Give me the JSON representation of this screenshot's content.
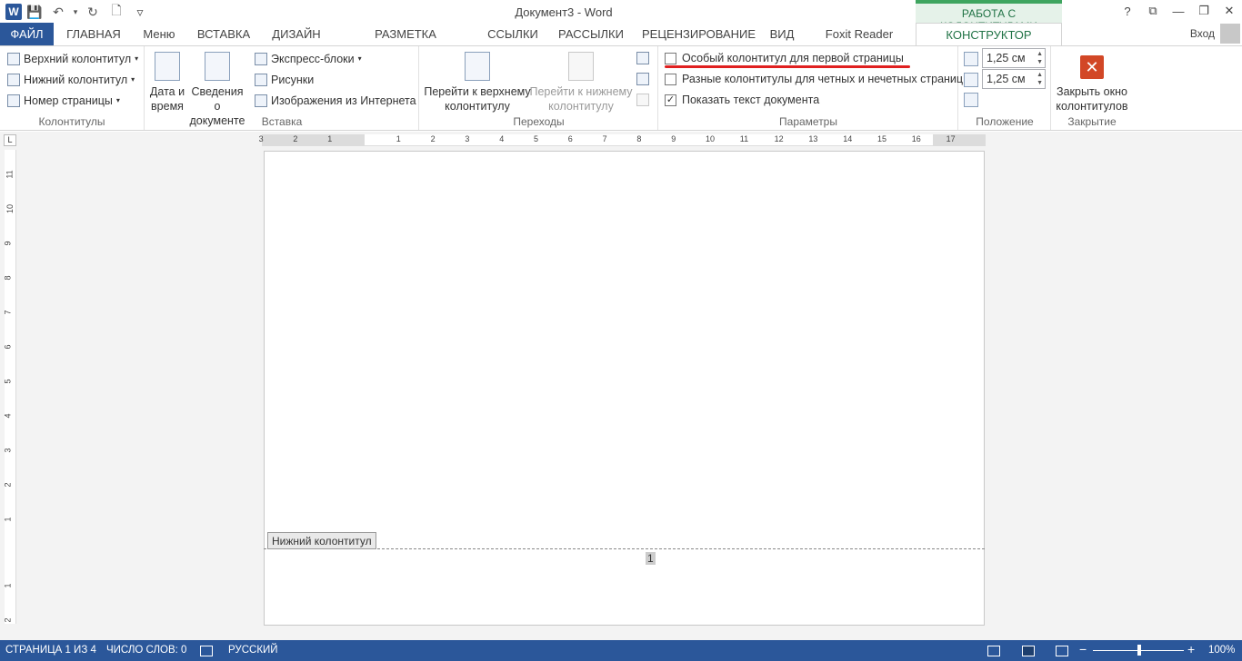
{
  "titlebar": {
    "title": "Документ3 - Word",
    "contextual_label": "РАБОТА С КОЛОНТИТУЛАМИ",
    "win_help": "?",
    "win_ribbon": "⧉",
    "win_minimize": "—",
    "win_restore": "❐",
    "win_close": "✕"
  },
  "qat": {
    "word_logo": "W",
    "save": "💾",
    "undo": "↶",
    "undo_arrow": "▾",
    "redo": "↻",
    "new": "🗋",
    "customize": "▿"
  },
  "tabs": {
    "file": "ФАЙЛ",
    "home": "ГЛАВНАЯ",
    "menu": "Меню",
    "insert": "ВСТАВКА",
    "design": "ДИЗАЙН",
    "layout": "РАЗМЕТКА СТРАНИЦЫ",
    "refs": "ССЫЛКИ",
    "mailings": "РАССЫЛКИ",
    "review": "РЕЦЕНЗИРОВАНИЕ",
    "view": "ВИД",
    "foxit": "Foxit Reader PDF",
    "constructor": "КОНСТРУКТОР",
    "signin": "Вход"
  },
  "ribbon": {
    "hf": {
      "header": "Верхний колонтитул",
      "footer": "Нижний колонтитул",
      "pagenum": "Номер страницы",
      "label": "Колонтитулы"
    },
    "insert": {
      "date_l1": "Дата и",
      "date_l2": "время",
      "docinfo_l1": "Сведения о",
      "docinfo_l2": "документе",
      "quickparts": "Экспресс-блоки",
      "pictures": "Рисунки",
      "online": "Изображения из Интернета",
      "label": "Вставка"
    },
    "nav": {
      "goheader_l1": "Перейти к верхнему",
      "goheader_l2": "колонтитулу",
      "gofooter_l1": "Перейти к нижнему",
      "gofooter_l2": "колонтитулу",
      "label": "Переходы"
    },
    "options": {
      "first_page": "Особый колонтитул для первой страницы",
      "odd_even": "Разные колонтитулы для четных и нечетных страниц",
      "show_text": "Показать текст документа",
      "label": "Параметры"
    },
    "position": {
      "header_val": "1,25 см",
      "footer_val": "1,25 см",
      "label": "Положение"
    },
    "close": {
      "btn_l1": "Закрыть окно",
      "btn_l2": "колонтитулов",
      "label": "Закрытие"
    },
    "collapse": "⌃"
  },
  "ruler": {
    "h_left": [
      "3",
      "2",
      "1"
    ],
    "h_right": [
      "1",
      "2",
      "3",
      "4",
      "5",
      "6",
      "7",
      "8",
      "9",
      "10",
      "11",
      "12",
      "13",
      "14",
      "15",
      "16",
      "17"
    ],
    "v_nums": [
      "11",
      "10",
      "9",
      "8",
      "7",
      "6",
      "5",
      "4",
      "3",
      "2",
      "1"
    ],
    "v_bottom": [
      "1",
      "2"
    ],
    "corner": "L"
  },
  "document": {
    "footer_tag": "Нижний колонтитул",
    "page_number": "1"
  },
  "status": {
    "page": "СТРАНИЦА 1 ИЗ 4",
    "words": "ЧИСЛО СЛОВ: 0",
    "lang": "РУССКИЙ",
    "zoom": "100%",
    "zoom_minus": "−",
    "zoom_plus": "+"
  },
  "colors": {
    "accent_blue": "#2b579a",
    "contextual_green": "#217346",
    "highlight_red": "#e02020"
  }
}
